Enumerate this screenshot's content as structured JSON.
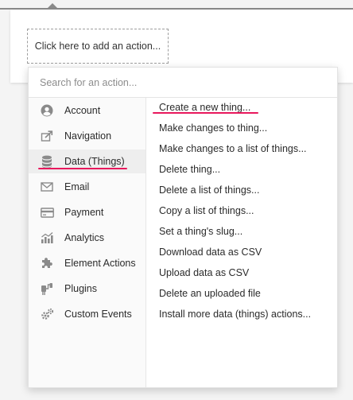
{
  "workflow": {
    "add_action_label": "Click here to add an action..."
  },
  "menu": {
    "search_placeholder": "Search for an action...",
    "categories": [
      {
        "label": "Account",
        "icon": "account-circle-icon"
      },
      {
        "label": "Navigation",
        "icon": "navigation-share-icon"
      },
      {
        "label": "Data (Things)",
        "icon": "database-icon",
        "selected": true
      },
      {
        "label": "Email",
        "icon": "envelope-icon"
      },
      {
        "label": "Payment",
        "icon": "credit-card-icon"
      },
      {
        "label": "Analytics",
        "icon": "analytics-chart-icon"
      },
      {
        "label": "Element Actions",
        "icon": "puzzle-icon"
      },
      {
        "label": "Plugins",
        "icon": "plug-icon"
      },
      {
        "label": "Custom Events",
        "icon": "gears-icon"
      }
    ],
    "actions": [
      "Create a new thing...",
      "Make changes to thing...",
      "Make changes to a list of things...",
      "Delete thing...",
      "Delete a list of things...",
      "Copy a list of things...",
      "Set a thing's slug...",
      "Download data as CSV",
      "Upload data as CSV",
      "Delete an uploaded file",
      "Install more data (things) actions..."
    ]
  },
  "colors": {
    "highlight_underline": "#e8185d",
    "icon_gray": "#8a8a8a"
  }
}
